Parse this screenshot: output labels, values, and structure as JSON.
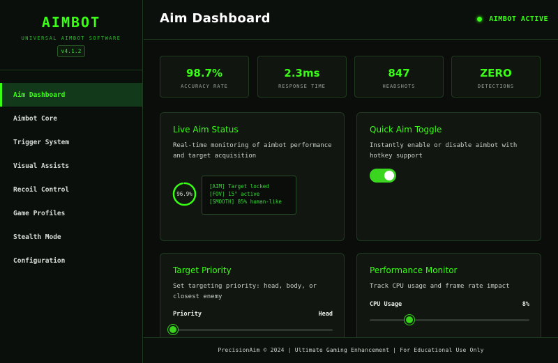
{
  "brand": {
    "title": "AIMBOT",
    "subtitle": "UNIVERSAL AIMBOT SOFTWARE",
    "version": "v4.1.2"
  },
  "sidebar": {
    "items": [
      {
        "label": "Aim Dashboard",
        "active": true
      },
      {
        "label": "Aimbot Core",
        "active": false
      },
      {
        "label": "Trigger System",
        "active": false
      },
      {
        "label": "Visual Assists",
        "active": false
      },
      {
        "label": "Recoil Control",
        "active": false
      },
      {
        "label": "Game Profiles",
        "active": false
      },
      {
        "label": "Stealth Mode",
        "active": false
      },
      {
        "label": "Configuration",
        "active": false
      }
    ]
  },
  "header": {
    "title": "Aim Dashboard",
    "status": "AIMBOT ACTIVE"
  },
  "stats": [
    {
      "value": "98.7%",
      "label": "ACCURACY RATE"
    },
    {
      "value": "2.3ms",
      "label": "RESPONSE TIME"
    },
    {
      "value": "847",
      "label": "HEADSHOTS"
    },
    {
      "value": "ZERO",
      "label": "DETECTIONS"
    }
  ],
  "live_status": {
    "title": "Live Aim Status",
    "description": "Real-time monitoring of aimbot performance and target acquisition",
    "ring_value": "96.9%",
    "ring_fraction": 0.969,
    "log": [
      "[AIM] Target locked",
      "[FOV] 15° active",
      "[SMOOTH] 85% human-like"
    ]
  },
  "quick_toggle": {
    "title": "Quick Aim Toggle",
    "description": "Instantly enable or disable aimbot with hotkey support",
    "enabled": true
  },
  "target_priority": {
    "title": "Target Priority",
    "description": "Set targeting priority: head, body, or closest enemy",
    "label": "Priority",
    "value": "Head",
    "slider_fraction": 0.0
  },
  "performance": {
    "title": "Performance Monitor",
    "description": "Track CPU usage and frame rate impact",
    "label": "CPU Usage",
    "value": "8%",
    "slider_fraction": 0.25
  },
  "footer": {
    "text": "PrecisionAim © 2024 | Ultimate Gaming Enhancement | For Educational Use Only"
  },
  "colors": {
    "accent": "#39ff14",
    "panel": "#111611",
    "border": "#1f3a1f"
  }
}
